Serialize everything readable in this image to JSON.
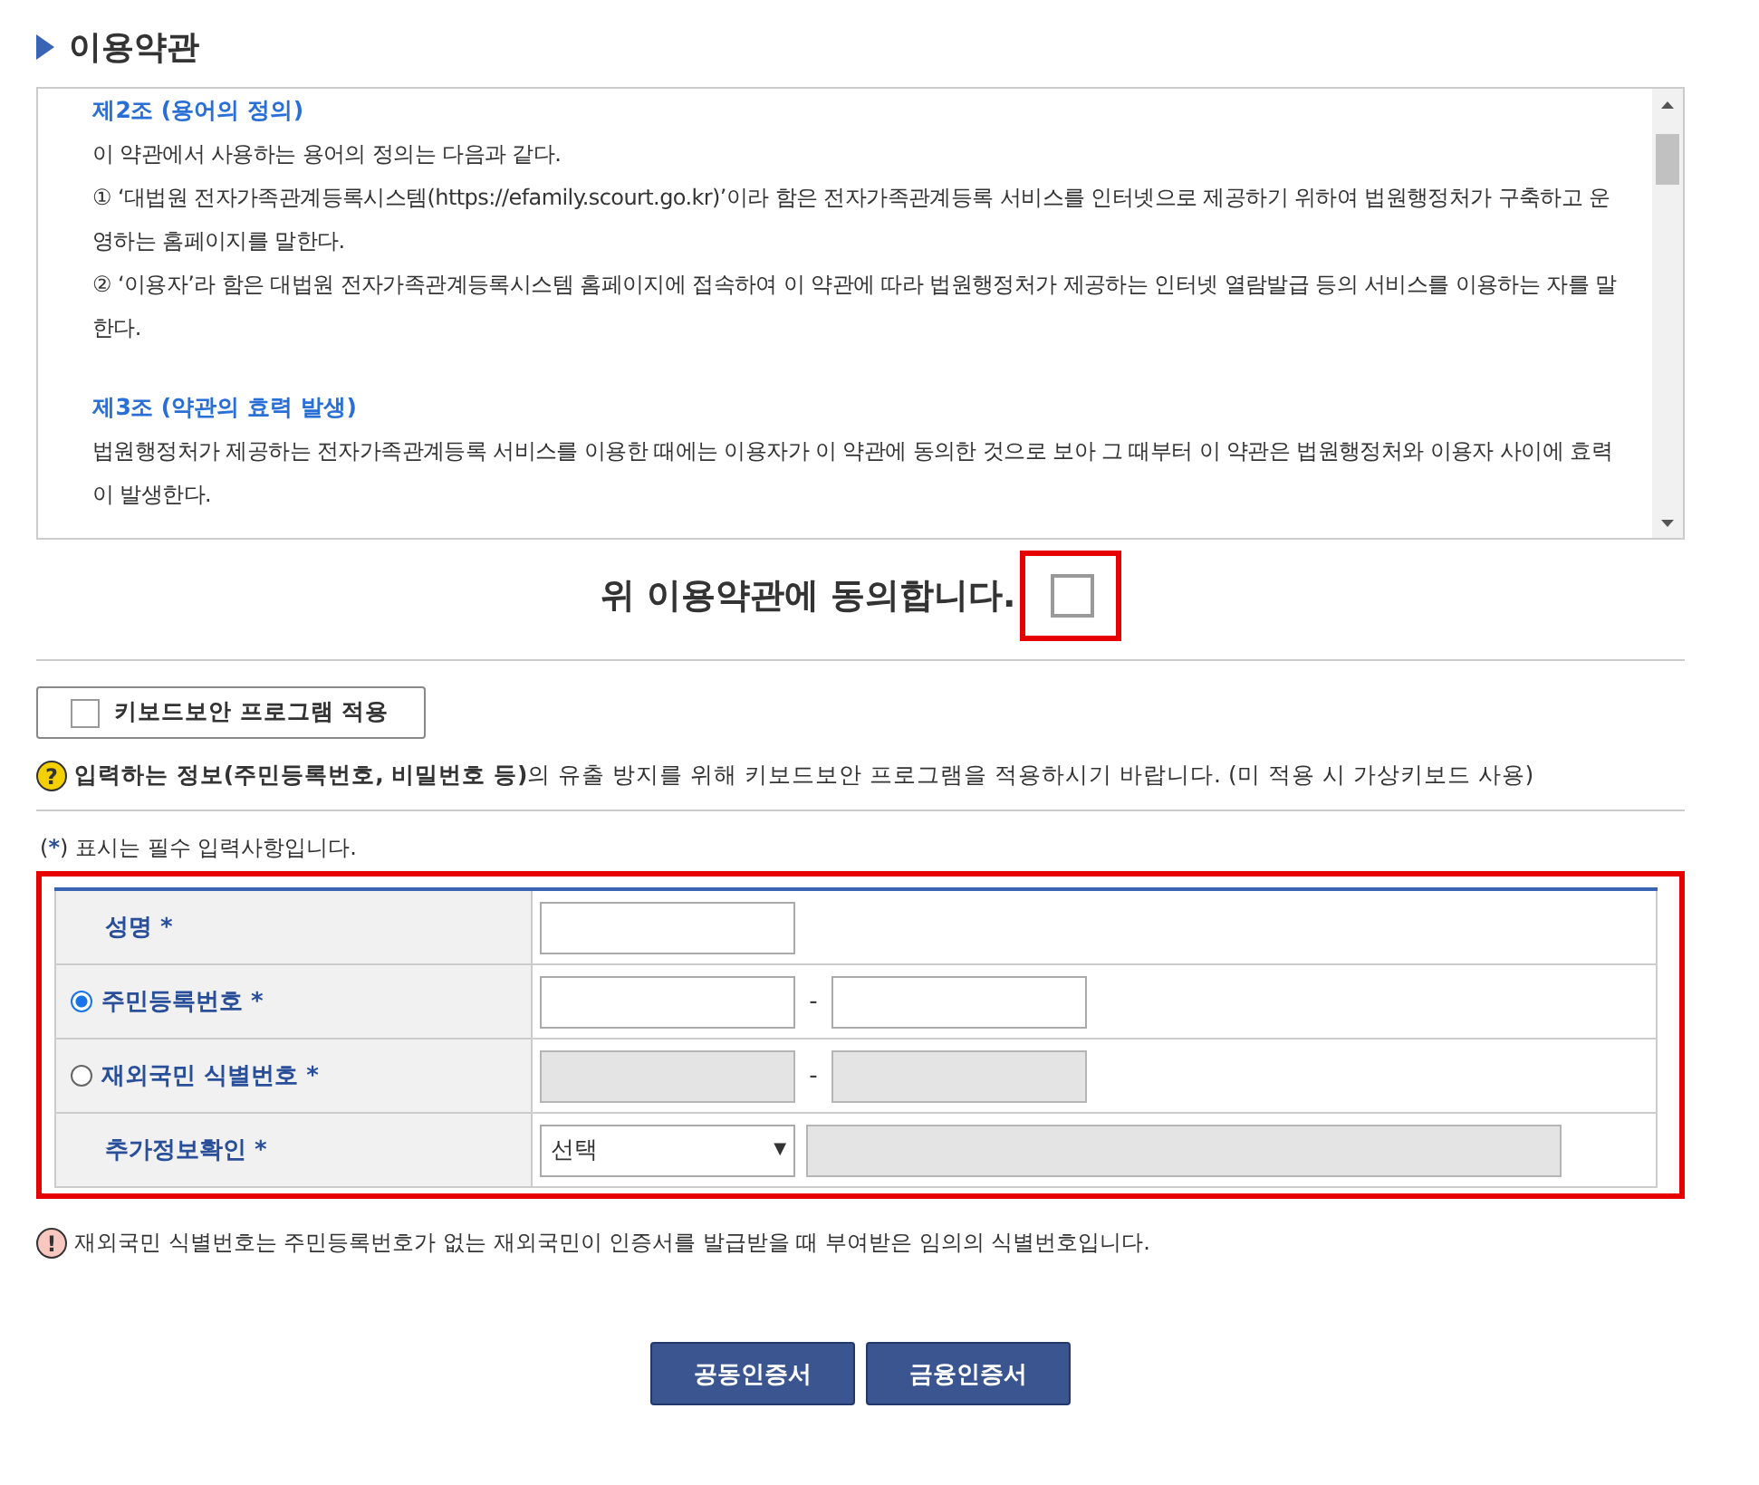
{
  "section_title": "이용약관",
  "terms": [
    {
      "kind": "heading",
      "text": "제2조 (용어의 정의)"
    },
    {
      "kind": "para",
      "text": "이 약관에서 사용하는 용어의 정의는 다음과 같다."
    },
    {
      "kind": "para",
      "text": "① ‘대법원 전자가족관계등록시스템(https://efamily.scourt.go.kr)’이라 함은 전자가족관계등록 서비스를 인터넷으로 제공하기 위하여 법원행정처가 구축하고 운영하는 홈페이지를 말한다."
    },
    {
      "kind": "para",
      "text": "② ‘이용자’라 함은 대법원 전자가족관계등록시스템 홈페이지에 접속하여 이 약관에 따라 법원행정처가 제공하는 인터넷 열람발급 등의 서비스를 이용하는 자를 말한다."
    },
    {
      "kind": "heading",
      "text": "제3조 (약관의 효력 발생)"
    },
    {
      "kind": "para",
      "text": "법원행정처가 제공하는 전자가족관계등록 서비스를 이용한 때에는 이용자가 이 약관에 동의한 것으로 보아 그 때부터 이 약관은 법원행정처와 이용자 사이에 효력이 발생한다."
    }
  ],
  "agree": {
    "label": "위 이용약관에 동의합니다.",
    "checked": false,
    "highlighted": true
  },
  "keyboard_security": {
    "label": "키보드보안 프로그램 적용",
    "checked": false
  },
  "security_notice": {
    "icon": "?",
    "text": "**입력하는 정보(주민등록번호, 비밀번호 등)**의 유출 방지를 위해 키보드보안 프로그램을 적용하시기 바랍니다. (미 적용 시 가상키보드 사용)"
  },
  "required_note": {
    "before": "(",
    "mark": "*",
    "after": ") 표시는 필수 입력사항입니다."
  },
  "form": {
    "highlighted": true,
    "rows": [
      {
        "kind": "text",
        "label": "성명",
        "required_mark": "*",
        "disabled": false
      },
      {
        "kind": "radio_split",
        "label": "주민등록번호",
        "required_mark": "*",
        "selected": true,
        "disabled": false,
        "separator": "-"
      },
      {
        "kind": "radio_split",
        "label": "재외국민 식별번호",
        "required_mark": "*",
        "selected": false,
        "disabled": true,
        "separator": "-"
      },
      {
        "kind": "select",
        "label": "추가정보확인",
        "required_mark": "*",
        "value": "선택",
        "caret": "▼",
        "disabled": true
      }
    ]
  },
  "info_notice": {
    "icon": "!",
    "text": "재외국민 식별번호는 주민등록번호가 없는 재외국민이 인증서를 발급받을 때 부여받은 임의의 식별번호입니다."
  },
  "buttons": [
    "공동인증서",
    "금융인증서"
  ]
}
